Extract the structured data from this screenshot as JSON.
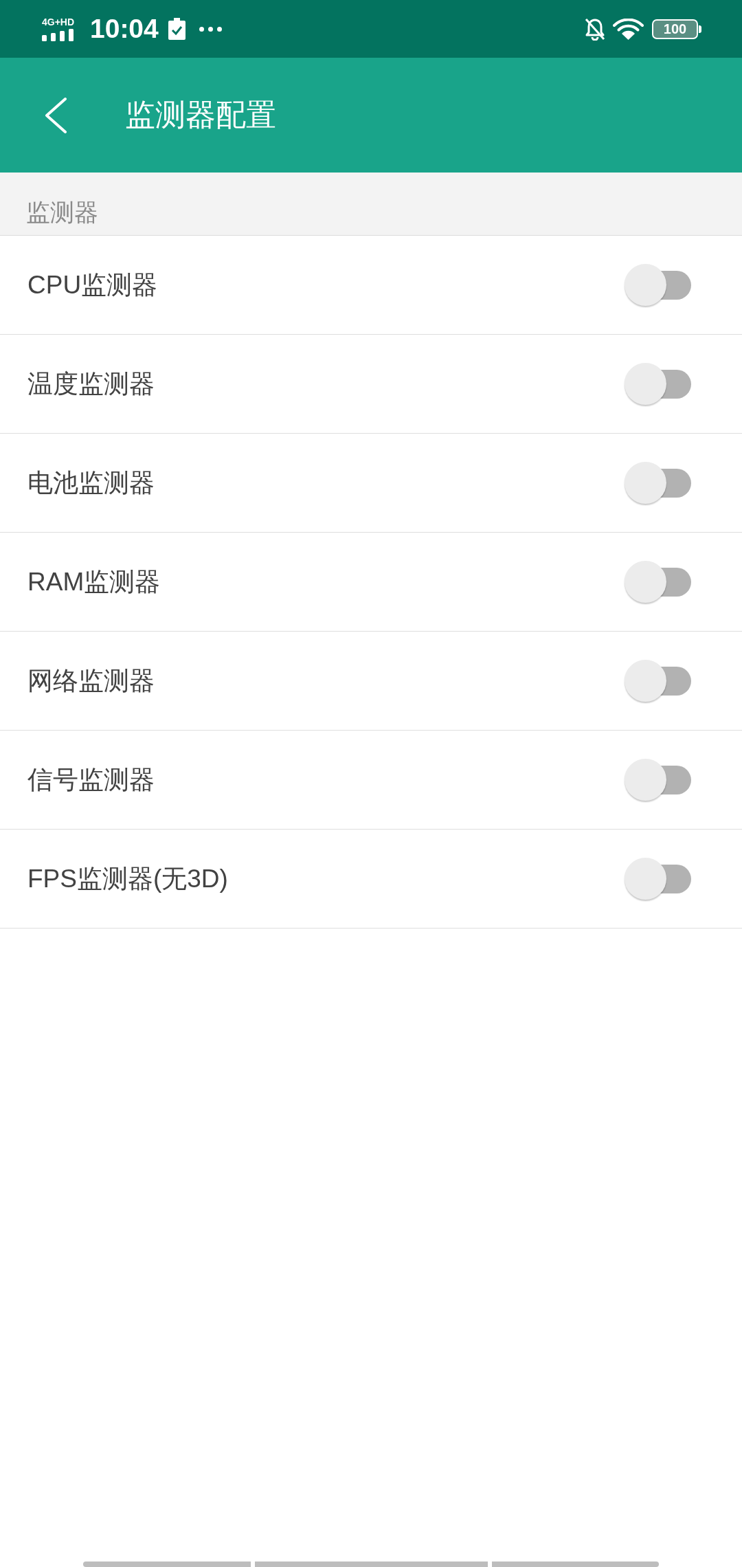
{
  "status_bar": {
    "network": "4G+HD",
    "time": "10:04",
    "battery": "100"
  },
  "app_bar": {
    "title": "监测器配置"
  },
  "section": {
    "title": "监测器"
  },
  "settings": [
    {
      "label": "CPU监测器",
      "on": false
    },
    {
      "label": "温度监测器",
      "on": false
    },
    {
      "label": "电池监测器",
      "on": false
    },
    {
      "label": "RAM监测器",
      "on": false
    },
    {
      "label": "网络监测器",
      "on": false
    },
    {
      "label": "信号监测器",
      "on": false
    },
    {
      "label": "FPS监测器(无3D)",
      "on": false
    }
  ]
}
